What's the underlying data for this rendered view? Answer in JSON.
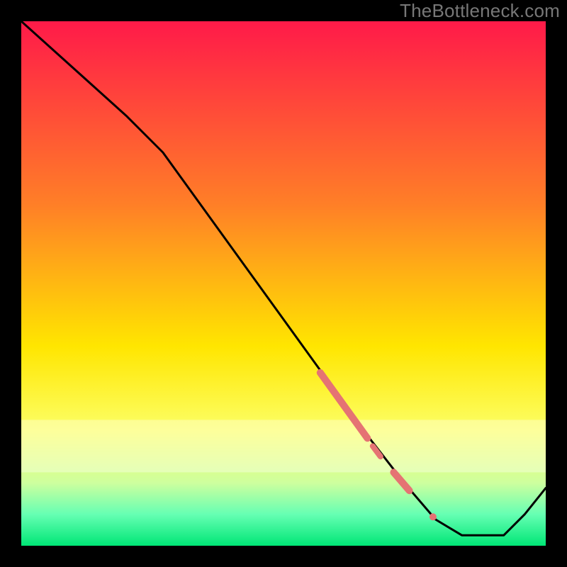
{
  "watermark": "TheBottleneck.com",
  "chart_data": {
    "type": "line",
    "xlim": [
      0,
      100
    ],
    "ylim": [
      0,
      100
    ],
    "title": "",
    "xlabel": "",
    "ylabel": "",
    "gradient_stops": [
      {
        "offset": 0,
        "color": "#ff1a49"
      },
      {
        "offset": 35,
        "color": "#ff7f27"
      },
      {
        "offset": 62,
        "color": "#ffe600"
      },
      {
        "offset": 78,
        "color": "#fcff66"
      },
      {
        "offset": 88,
        "color": "#ceff9e"
      },
      {
        "offset": 94,
        "color": "#66ffb3"
      },
      {
        "offset": 100,
        "color": "#00e676"
      }
    ],
    "curve": [
      {
        "x": 0,
        "y": 100
      },
      {
        "x": 20,
        "y": 82
      },
      {
        "x": 27,
        "y": 75
      },
      {
        "x": 66,
        "y": 21
      },
      {
        "x": 73,
        "y": 12
      },
      {
        "x": 79,
        "y": 5
      },
      {
        "x": 84,
        "y": 2
      },
      {
        "x": 92,
        "y": 2
      },
      {
        "x": 96,
        "y": 6
      },
      {
        "x": 100,
        "y": 11
      }
    ],
    "highlight_segments": [
      {
        "x1": 57,
        "y1": 33,
        "x2": 66,
        "y2": 20.5,
        "w": 10
      },
      {
        "x1": 67,
        "y1": 19,
        "x2": 68.5,
        "y2": 17,
        "w": 8
      },
      {
        "x1": 71,
        "y1": 14,
        "x2": 74,
        "y2": 10.5,
        "w": 10
      }
    ],
    "highlight_dots": [
      {
        "x": 78.5,
        "y": 5.5,
        "r": 5
      }
    ],
    "highlight_color": "#e57373"
  }
}
